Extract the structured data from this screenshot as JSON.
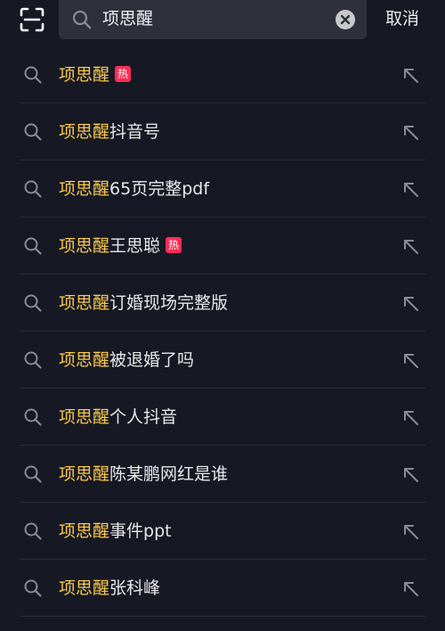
{
  "search": {
    "query": "项思醒",
    "cancel_label": "取消"
  },
  "suggestions": [
    {
      "highlight": "项思醒",
      "rest": "",
      "badge": "热"
    },
    {
      "highlight": "项思醒",
      "rest": "抖音号",
      "badge": ""
    },
    {
      "highlight": "项思醒",
      "rest": "65页完整pdf",
      "badge": ""
    },
    {
      "highlight": "项思醒",
      "rest": "王思聪",
      "badge": "热"
    },
    {
      "highlight": "项思醒",
      "rest": "订婚现场完整版",
      "badge": ""
    },
    {
      "highlight": "项思醒",
      "rest": "被退婚了吗",
      "badge": ""
    },
    {
      "highlight": "项思醒",
      "rest": "个人抖音",
      "badge": ""
    },
    {
      "highlight": "项思醒",
      "rest": "陈某鹏网红是谁",
      "badge": ""
    },
    {
      "highlight": "项思醒",
      "rest": "事件ppt",
      "badge": ""
    },
    {
      "highlight": "项思醒",
      "rest": "张科峰",
      "badge": ""
    }
  ],
  "colors": {
    "background": "#161823",
    "search_box": "#2e303b",
    "highlight": "#f9c94b",
    "hot_badge": "#fe2c55"
  },
  "icons": {
    "scan": "scan-icon",
    "search": "search-icon",
    "clear": "clear-icon",
    "fill_query": "arrow-up-left-icon"
  }
}
